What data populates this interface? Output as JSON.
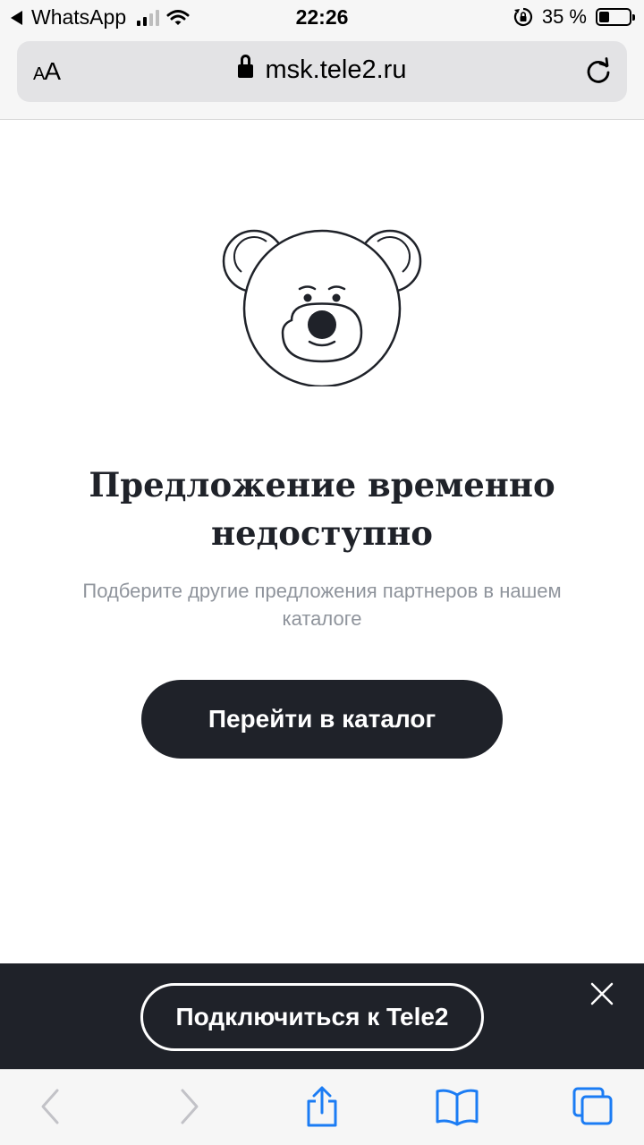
{
  "status_bar": {
    "back_app": "WhatsApp",
    "time": "22:26",
    "battery_percent": "35 %",
    "battery_level": 0.35,
    "signal_bars_active": 2,
    "signal_bars_total": 4
  },
  "browser": {
    "text_size_label": {
      "small": "A",
      "large": "A"
    },
    "url": "msk.tele2.ru"
  },
  "content": {
    "title": "Предложение временно недоступно",
    "subtitle": "Подберите другие предложения партнеров в нашем каталоге",
    "catalog_button": "Перейти в каталог"
  },
  "banner": {
    "connect_button": "Подключиться к Tele2"
  },
  "toolbar": {
    "icons": [
      "back-icon",
      "forward-icon",
      "share-icon",
      "bookmarks-icon",
      "tabs-icon"
    ]
  },
  "colors": {
    "dark": "#1f2229",
    "subtitle_gray": "#8f949c",
    "toolbar_blue": "#1b7cf4",
    "disabled_gray": "#c2c2c7"
  }
}
